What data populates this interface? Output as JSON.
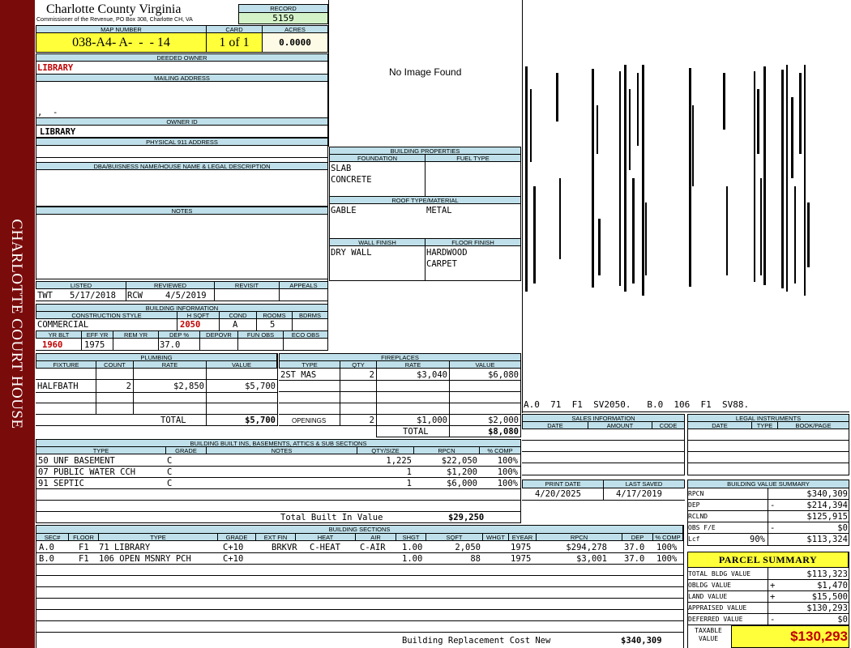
{
  "side_label": "CHARLOTTE COURT HOUSE",
  "header": {
    "county": "Charlotte County Virginia",
    "subtitle": "Commissioner of the Revenue, PO Box 308, Charlotte CH, VA",
    "record_label": "RECORD",
    "record": "5159",
    "map_label": "MAP NUMBER",
    "map_number": "038-A4- A-  -  - 14",
    "card_label": "CARD",
    "card": "1 of 1",
    "acres_label": "ACRES",
    "acres": "0.0000"
  },
  "owner": {
    "deeded_label": "DEEDED OWNER",
    "deeded": "LIBRARY",
    "mailing_label": "MAILING ADDRESS",
    "mailing_line": ",  -",
    "owner_id_label": "OWNER ID",
    "owner_id": "LIBRARY",
    "physical_label": "PHYSICAL 911 ADDRESS",
    "dba_label": "DBA/BUISNESS NAME/HOUSE NAME & LEGAL DESCRIPTION",
    "notes_label": "NOTES"
  },
  "image_text": "No Image Found",
  "sketch_caption": "A.0  71  F1  SV2050.   B.0  106  F1  SV88.",
  "props": {
    "title": "BUILDING PROPERTIES",
    "foundation_label": "FOUNDATION",
    "fuel_label": "FUEL TYPE",
    "foundation1": "SLAB",
    "foundation2": "CONCRETE",
    "roof_label": "ROOF TYPE/MATERIAL",
    "roof_type": "GABLE",
    "roof_material": "METAL",
    "wall_label": "WALL FINISH",
    "floor_label": "FLOOR FINISH",
    "wall": "DRY WALL",
    "floor1": "HARDWOOD",
    "floor2": "CARPET"
  },
  "listing": {
    "listed_label": "LISTED",
    "reviewed_label": "REVIEWED",
    "revisit_label": "REVISIT",
    "appeals_label": "APPEALS",
    "listed_by": "TWT",
    "listed_date": "5/17/2018",
    "reviewed_by": "RCW",
    "reviewed_date": "4/5/2019"
  },
  "bldg_info": {
    "title": "BUILDING INFORMATION",
    "style_label": "CONSTRUCTION STYLE",
    "hsqft_label": "H SQFT",
    "cond_label": "COND",
    "rooms_label": "ROOMS",
    "bdrms_label": "BDRMS",
    "style": "COMMERCIAL",
    "hsqft": "2050",
    "cond": "A",
    "rooms": "5",
    "yrblt_label": "YR BLT",
    "effyr_label": "EFF YR",
    "remyr_label": "REM YR",
    "dep_label": "DEP %",
    "depovr_label": "DEPOVR",
    "funobs_label": "FUN OBS",
    "ecoobs_label": "ECO OBS",
    "yrblt": "1960",
    "effyr": "1975",
    "dep": "37.0"
  },
  "plumbing": {
    "title": "PLUMBING",
    "cols": [
      "FIXTURE",
      "COUNT",
      "RATE",
      "VALUE"
    ],
    "fixture": "HALFBATH",
    "count": "2",
    "rate": "$2,850",
    "value": "$5,700",
    "total_label": "TOTAL",
    "total": "$5,700"
  },
  "fireplaces": {
    "title": "FIREPLACES",
    "cols": [
      "TYPE",
      "QTY",
      "RATE",
      "VALUE"
    ],
    "type": "2ST MAS",
    "qty": "2",
    "rate": "$3,040",
    "value": "$6,080",
    "openings_label": "OPENINGS",
    "openings_qty": "2",
    "openings_rate": "$1,000",
    "openings_value": "$2,000",
    "total_label": "TOTAL",
    "total": "$8,080"
  },
  "sales": {
    "title": "SALES INFORMATION",
    "cols": [
      "DATE",
      "AMOUNT",
      "CODE"
    ]
  },
  "legal": {
    "title": "LEGAL INSTRUMENTS",
    "cols": [
      "DATE",
      "TYPE",
      "BOOK/PAGE"
    ]
  },
  "builtins": {
    "title": "BUILDING BUILT INS, BASEMENTS, ATTICS & SUB SECTIONS",
    "cols": [
      "TYPE",
      "GRADE",
      "NOTES",
      "QTY/SIZE",
      "RPCN",
      "% COMP"
    ],
    "rows": [
      {
        "type": "50 UNF BASEMENT",
        "grade": "C",
        "qty": "1,225",
        "rpcn": "$22,050",
        "comp": "100%"
      },
      {
        "type": "07 PUBLIC WATER CCH",
        "grade": "C",
        "qty": "1",
        "rpcn": "$1,200",
        "comp": "100%"
      },
      {
        "type": "91 SEPTIC",
        "grade": "C",
        "qty": "1",
        "rpcn": "$6,000",
        "comp": "100%"
      }
    ],
    "total_label": "Total Built In Value",
    "total": "$29,250"
  },
  "dates": {
    "print_label": "PRINT DATE",
    "saved_label": "LAST SAVED",
    "print": "4/20/2025",
    "saved": "4/17/2019"
  },
  "value_summary": {
    "title": "BUILDING VALUE SUMMARY",
    "rpcn_label": "RPCN",
    "rpcn": "$340,309",
    "dep_label": "DEP",
    "dep_sign": "-",
    "dep": "$214,394",
    "rclnd_label": "RCLND",
    "rclnd": "$125,915",
    "obs_label": "OBS F/E",
    "obs_sign": "-",
    "obs": "$0",
    "lcf_label": "Lcf",
    "lcf_pct": "90%",
    "lcf": "$113,324"
  },
  "sections": {
    "title": "BUILDING SECTIONS",
    "cols": [
      "SEC#",
      "FLOOR",
      "TYPE",
      "GRADE",
      "EXT FIN",
      "HEAT",
      "AIR",
      "SHGT",
      "SQFT",
      "WHGT",
      "EYEAR",
      "RPCN",
      "DEP",
      "% COMP"
    ],
    "rows": [
      {
        "sec": "A.0",
        "floor": "F1",
        "type": "71 LIBRARY",
        "grade": "C+10",
        "ext": "BRKVR",
        "heat": "C-HEAT",
        "air": "C-AIR",
        "shgt": "1.00",
        "sqft": "2,050",
        "eyear": "1975",
        "rpcn": "$294,278",
        "dep": "37.0",
        "comp": "100%"
      },
      {
        "sec": "B.0",
        "floor": "F1",
        "type": "106 OPEN MSNRY PCH",
        "grade": "C+10",
        "ext": "",
        "heat": "",
        "air": "",
        "shgt": "1.00",
        "sqft": "88",
        "eyear": "1975",
        "rpcn": "$3,001",
        "dep": "37.0",
        "comp": "100%"
      }
    ],
    "brcn_label": "Building Replacement Cost New",
    "brcn": "$340,309"
  },
  "parcel": {
    "title": "PARCEL SUMMARY",
    "bldg_label": "TOTAL BLDG VALUE",
    "bldg": "$113,323",
    "obldg_label": "OBLDG VALUE",
    "obldg_sign": "+",
    "obldg": "$1,470",
    "land_label": "LAND VALUE",
    "land_sign": "+",
    "land": "$15,500",
    "appraised_label": "APPRAISED VALUE",
    "appraised": "$130,293",
    "deferred_label": "DEFERRED VALUE",
    "deferred_sign": "-",
    "deferred": "$0",
    "taxable_label1": "TAXABLE",
    "taxable_label2": "VALUE",
    "taxable": "$130,293"
  },
  "colors": {
    "sidebar": "#7a0b0b",
    "header_fill": "#bfe0ea",
    "highlight": "#ffff3a",
    "record_fill": "#d3f2c8",
    "accent_red": "#c00000"
  }
}
